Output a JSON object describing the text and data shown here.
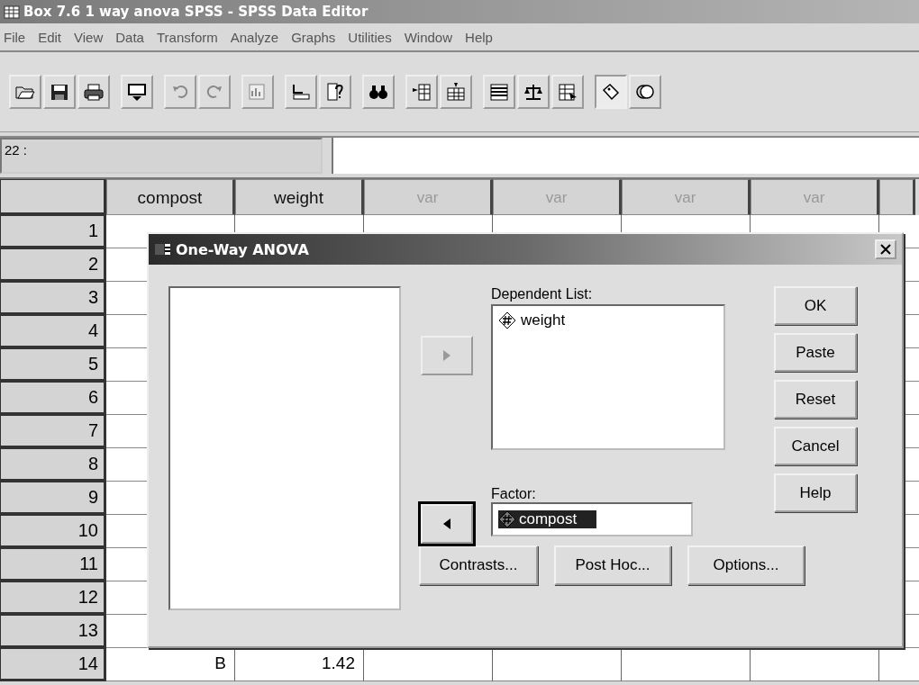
{
  "window": {
    "title": "Box 7.6 1 way anova SPSS - SPSS Data Editor"
  },
  "menu": [
    "File",
    "Edit",
    "View",
    "Data",
    "Transform",
    "Analyze",
    "Graphs",
    "Utilities",
    "Window",
    "Help"
  ],
  "toolbar": {
    "value_labels_on": true
  },
  "cell_reference": "22 :",
  "grid": {
    "columns": [
      {
        "name": "compost",
        "kind": "variable"
      },
      {
        "name": "weight",
        "kind": "variable"
      },
      {
        "name": "var",
        "kind": "empty"
      },
      {
        "name": "var",
        "kind": "empty"
      },
      {
        "name": "var",
        "kind": "empty"
      },
      {
        "name": "var",
        "kind": "empty"
      }
    ],
    "rows": [
      {
        "number": "1",
        "cells": []
      },
      {
        "number": "2",
        "cells": []
      },
      {
        "number": "3",
        "cells": []
      },
      {
        "number": "4",
        "cells": []
      },
      {
        "number": "5",
        "cells": []
      },
      {
        "number": "6",
        "cells": []
      },
      {
        "number": "7",
        "cells": []
      },
      {
        "number": "8",
        "cells": []
      },
      {
        "number": "9",
        "cells": []
      },
      {
        "number": "10",
        "cells": []
      },
      {
        "number": "11",
        "cells": []
      },
      {
        "number": "12",
        "cells": []
      },
      {
        "number": "13",
        "cells": []
      },
      {
        "number": "14",
        "cells": [
          "B",
          "1.42"
        ]
      }
    ]
  },
  "dialog": {
    "title": "One-Way ANOVA",
    "dependent_list": {
      "label": "Dependent List:",
      "items": [
        "weight"
      ]
    },
    "factor": {
      "label": "Factor:",
      "value": "compost",
      "selected": true
    },
    "move_buttons": [
      {
        "kind": "right",
        "disabled": true,
        "focused": false
      },
      {
        "kind": "left",
        "disabled": false,
        "focused": true
      }
    ],
    "side_buttons": [
      "OK",
      "Paste",
      "Reset",
      "Cancel",
      "Help"
    ],
    "bottom_buttons": [
      "Contrasts...",
      "Post Hoc...",
      "Options..."
    ]
  }
}
